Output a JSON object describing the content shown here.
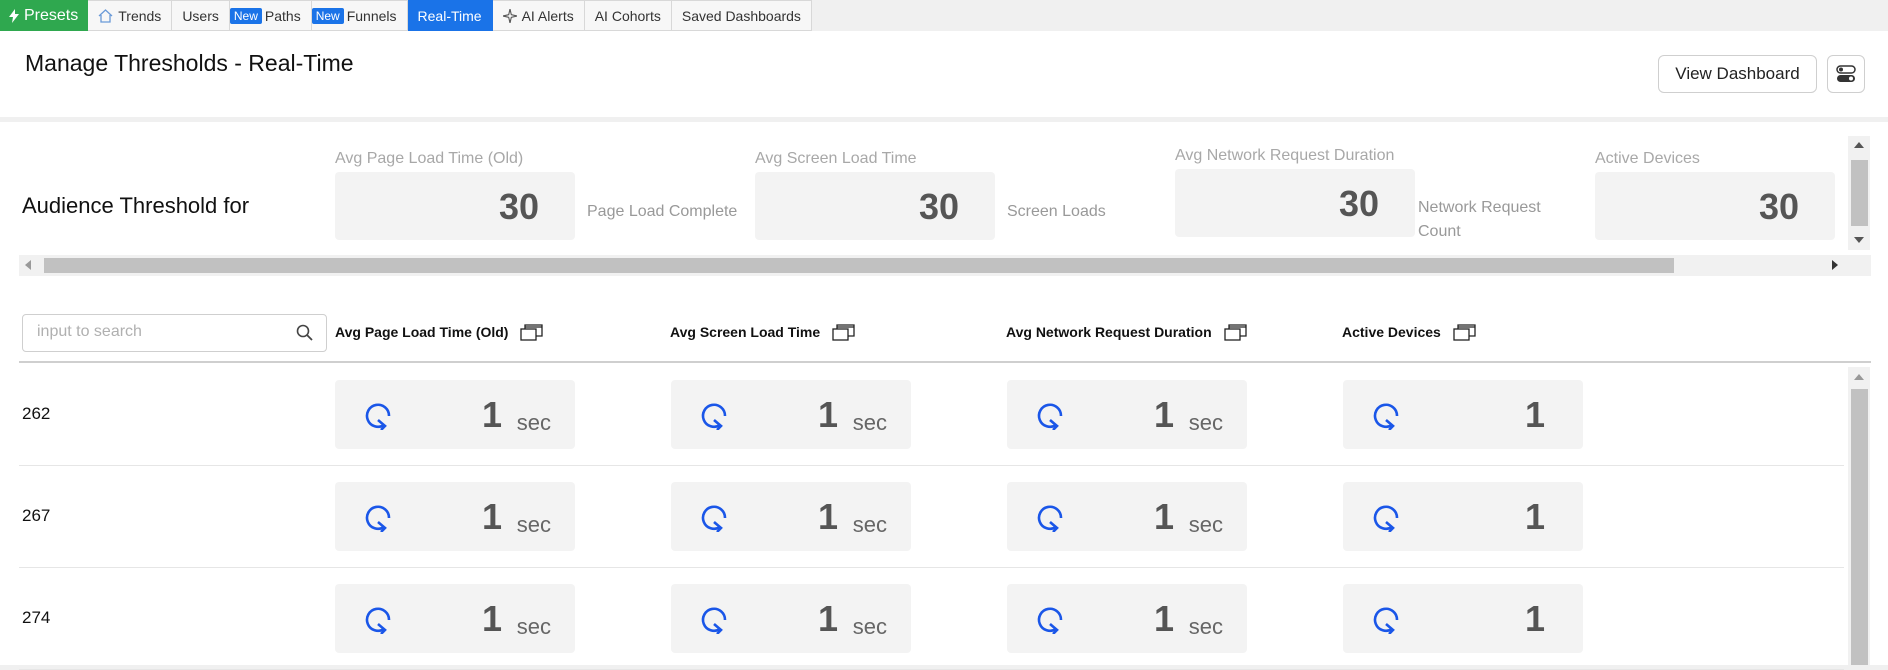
{
  "nav": {
    "presets": "Presets",
    "tabs": [
      {
        "label": "Trends",
        "icon": "home-icon"
      },
      {
        "label": "Users"
      },
      {
        "label": "Paths",
        "badge": "New"
      },
      {
        "label": "Funnels",
        "badge": "New"
      },
      {
        "label": "Real-Time",
        "active": true
      },
      {
        "label": "AI Alerts",
        "icon": "sparkle-icon"
      },
      {
        "label": "AI Cohorts"
      },
      {
        "label": "Saved Dashboards"
      }
    ]
  },
  "header": {
    "title": "Manage Thresholds - Real-Time",
    "view_dashboard": "View Dashboard"
  },
  "threshold": {
    "label": "Audience Threshold for",
    "columns": [
      {
        "label": "Avg Page Load Time (Old)",
        "value": "30",
        "metric": "Page Load Complete"
      },
      {
        "label": "Avg Screen Load Time",
        "value": "30",
        "metric": "Screen Loads"
      },
      {
        "label": "Avg Network Request Duration",
        "value": "30",
        "metric_line1": "Network Request",
        "metric_line2": "Count"
      },
      {
        "label": "Active Devices",
        "value": "30"
      }
    ]
  },
  "search": {
    "placeholder": "input to search"
  },
  "table": {
    "headers": [
      "Avg Page Load Time (Old)",
      "Avg Screen Load Time",
      "Avg Network Request Duration",
      "Active Devices"
    ],
    "rows": [
      {
        "id": "262",
        "cells": [
          {
            "value": "1",
            "unit": "sec"
          },
          {
            "value": "1",
            "unit": "sec"
          },
          {
            "value": "1",
            "unit": "sec"
          },
          {
            "value": "1"
          }
        ]
      },
      {
        "id": "267",
        "cells": [
          {
            "value": "1",
            "unit": "sec"
          },
          {
            "value": "1",
            "unit": "sec"
          },
          {
            "value": "1",
            "unit": "sec"
          },
          {
            "value": "1"
          }
        ]
      },
      {
        "id": "274",
        "cells": [
          {
            "value": "1",
            "unit": "sec"
          },
          {
            "value": "1",
            "unit": "sec"
          },
          {
            "value": "1",
            "unit": "sec"
          },
          {
            "value": "1"
          }
        ]
      }
    ]
  },
  "colors": {
    "accent": "#1a73e8",
    "presets": "#2fa84f",
    "loop_icon": "#1a56e8"
  }
}
